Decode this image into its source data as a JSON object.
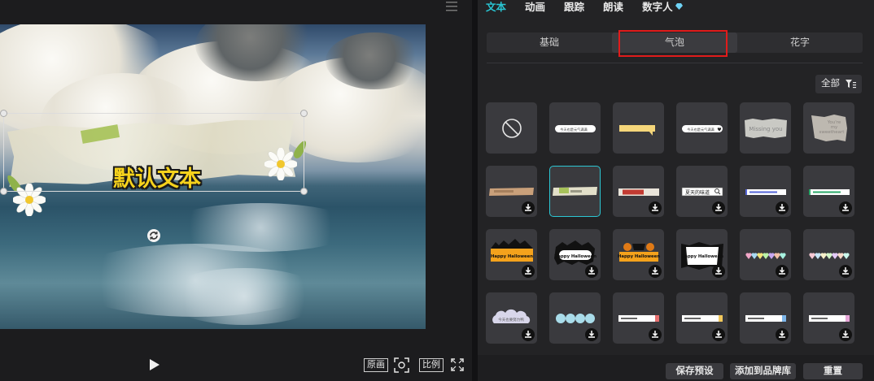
{
  "player": {
    "overlay_text": "默认文本",
    "controls": {
      "original_label": "原画",
      "ratio_label": "比例"
    }
  },
  "panel": {
    "tabs": [
      {
        "label": "文本",
        "active": true
      },
      {
        "label": "动画",
        "active": false
      },
      {
        "label": "跟踪",
        "active": false
      },
      {
        "label": "朗读",
        "active": false
      },
      {
        "label": "数字人",
        "active": false
      }
    ],
    "subtabs": [
      {
        "label": "基础",
        "active": false
      },
      {
        "label": "气泡",
        "active": true
      },
      {
        "label": "花字",
        "active": false
      }
    ],
    "filter_label": "全部",
    "bubble_items": [
      {
        "type": "none",
        "text": "",
        "downloaded": true
      },
      {
        "type": "pill",
        "text": "今天也是元气满满",
        "downloaded": true
      },
      {
        "type": "yellow-note",
        "text": "",
        "downloaded": true
      },
      {
        "type": "pill-heart",
        "text": "今天也是元气满满",
        "downloaded": true
      },
      {
        "type": "paper-gray",
        "text": "Missing you",
        "downloaded": true
      },
      {
        "type": "paper-torn",
        "text": "You're my sweetheart",
        "downloaded": true
      },
      {
        "type": "tape-brown",
        "text": "",
        "downloaded": false
      },
      {
        "type": "tape-green",
        "text": "",
        "downloaded": true,
        "selected": true
      },
      {
        "type": "label-red",
        "text": "",
        "downloaded": false
      },
      {
        "type": "search-box",
        "text": "夏天的味道",
        "downloaded": false
      },
      {
        "type": "bar-blue",
        "text": "",
        "downloaded": false
      },
      {
        "type": "bar-green",
        "text": "",
        "downloaded": false
      },
      {
        "type": "halloween-orange",
        "text": "Happy Halloween",
        "downloaded": false
      },
      {
        "type": "halloween-white",
        "text": "Happy Halloween",
        "downloaded": false
      },
      {
        "type": "halloween-pumpkin",
        "text": "Happy Halloween",
        "downloaded": false
      },
      {
        "type": "halloween-scroll",
        "text": "Happy Halloween",
        "downloaded": false
      },
      {
        "type": "hearts-colorful",
        "text": "",
        "downloaded": false
      },
      {
        "type": "hearts-pastel",
        "text": "",
        "downloaded": false
      },
      {
        "type": "cloud-gray",
        "text": "",
        "downloaded": false
      },
      {
        "type": "circles-blue",
        "text": "",
        "downloaded": false
      },
      {
        "type": "bar-red",
        "text": "",
        "downloaded": false
      },
      {
        "type": "bar-yellow",
        "text": "",
        "downloaded": false
      },
      {
        "type": "bar-blue2",
        "text": "",
        "downloaded": false
      },
      {
        "type": "bar-pink",
        "text": "",
        "downloaded": false
      }
    ],
    "buttons": {
      "save_preset": "保存预设",
      "add_brand": "添加到品牌库",
      "reset": "重置"
    }
  },
  "colors": {
    "accent": "#29c4d2",
    "highlight_box": "#e11b1b",
    "text_yellow": "#f6d21c"
  }
}
